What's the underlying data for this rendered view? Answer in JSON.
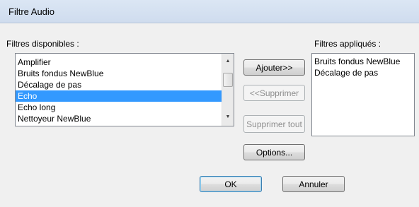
{
  "window": {
    "title": "Filtre Audio"
  },
  "available": {
    "label": "Filtres disponibles :",
    "items": [
      {
        "label": "Amplifier",
        "selected": false
      },
      {
        "label": "Bruits fondus NewBlue",
        "selected": false
      },
      {
        "label": "Décalage de pas",
        "selected": false
      },
      {
        "label": "Echo",
        "selected": true
      },
      {
        "label": "Echo long",
        "selected": false
      },
      {
        "label": "Nettoyeur NewBlue",
        "selected": false
      }
    ]
  },
  "applied": {
    "label": "Filtres appliqués :",
    "items": [
      {
        "label": "Bruits fondus NewBlue"
      },
      {
        "label": "Décalage de pas"
      }
    ]
  },
  "buttons": {
    "add": "Ajouter>>",
    "remove": "<<Supprimer",
    "remove_all": "Supprimer tout",
    "options": "Options...",
    "ok": "OK",
    "cancel": "Annuler"
  },
  "icons": {
    "scroll_up": "triangle-up-icon",
    "scroll_down": "triangle-down-icon"
  },
  "colors": {
    "selection": "#3399ff",
    "dialog_bg": "#f0f0f0"
  }
}
